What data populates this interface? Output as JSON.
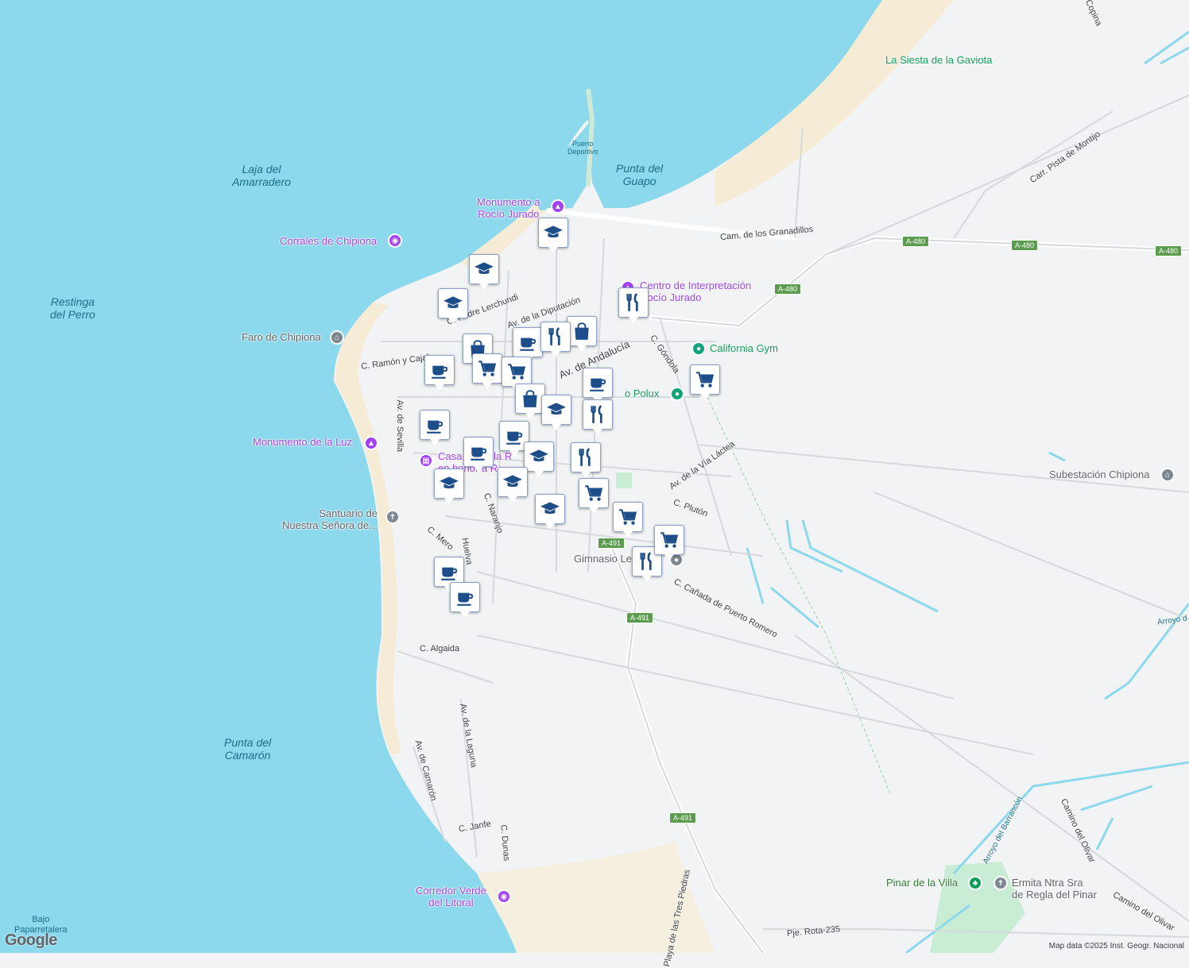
{
  "water_labels": [
    {
      "text": "Laja del\nAmarradero"
    },
    {
      "text": "Restinga\ndel Perro"
    },
    {
      "text": "Punta del\nCamarón"
    },
    {
      "text": "Punta del\nGuapo"
    },
    {
      "text": "Bajo\nPaparretalera"
    }
  ],
  "streets": {
    "c_padre_lerchundi": "C. Padre Lerchundi",
    "av_diputacion": "Av. de la Diputación",
    "av_andalucia": "Av. de Andalucía",
    "c_ramon_cajal": "C. Ramón y Cajal",
    "av_sevilla": "Av. de Sevilla",
    "c_gondola": "C. Góndola",
    "av_via_lactea": "Av. de la Vía Láctea",
    "c_pluton": "C. Plutón",
    "c_naranjo": "C. Naranjo",
    "c_mero": "C. Mero",
    "huelva": "Huelva",
    "c_canada": "C. Cañada de Puerto Romero",
    "c_algaida": "C. Algaida",
    "av_laguna": "Av. de la Laguna",
    "av_camaron": "Av. de Camarón",
    "c_janfe": "C. Janfe",
    "c_dunas": "C. Dunas",
    "cam_granadillos": "Cam. de los Granadillos",
    "carr_pista": "Carr. Pista de Montijo",
    "copina": "Copina",
    "tres_piedras": "Playa de las Tres Piedras",
    "pje_rota": "Pje. Rota-235",
    "camino_olivar": "Camino del Olivar",
    "camino_olivar2": "Camino del Olivar",
    "arroyo_barrancon": "Arroyo del Barrancón",
    "arroyo_edge": "Arroyo d"
  },
  "pois": {
    "monumento_rocio": "Monumento a\nRocío Jurado",
    "corrales": "Corrales de Chipiona",
    "faro": "Faro de Chipiona",
    "centro_interp": "Centro de Interpretación\nRocío Jurado",
    "california_gym": "California Gym",
    "polux": "o Polux",
    "monumento_luz": "Monumento de la Luz",
    "casa_escuela": "Casa Escuela R\nen honor a R",
    "santuario": "Santuario de\nNuestra Señora de...",
    "gimnasio": "Gimnasio Le",
    "subestacion": "Subestación Chipiona",
    "siesta": "La Siesta de la Gaviota",
    "puerto": "Puerto\nDeportivo",
    "corredor": "Corredor Verde\ndel Litoral",
    "pinar": "Pinar de la Villa",
    "ermita": "Ermita Ntra Sra\nde Regla del Pinar"
  },
  "roads": {
    "a480_1": "A-480",
    "a480_2": "A-480",
    "a480_3": "A-480",
    "a480_4": "A-480",
    "a491_1": "A-491",
    "a491_2": "A-491",
    "a491_3": "A-491"
  },
  "markers": [
    {
      "icon": "school-icon"
    },
    {
      "icon": "school-icon"
    },
    {
      "icon": "school-icon"
    },
    {
      "icon": "restaurant-icon"
    },
    {
      "icon": "shopping-bag-icon"
    },
    {
      "icon": "shopping-bag-icon"
    },
    {
      "icon": "coffee-icon"
    },
    {
      "icon": "coffee-icon"
    },
    {
      "icon": "shopping-cart-icon"
    },
    {
      "icon": "shopping-cart-icon"
    },
    {
      "icon": "coffee-icon"
    },
    {
      "icon": "coffee-icon"
    },
    {
      "icon": "restaurant-icon"
    },
    {
      "icon": "shopping-bag-icon"
    },
    {
      "icon": "school-icon"
    },
    {
      "icon": "restaurant-icon"
    },
    {
      "icon": "coffee-icon"
    },
    {
      "icon": "coffee-icon"
    },
    {
      "icon": "school-icon"
    },
    {
      "icon": "school-icon"
    },
    {
      "icon": "school-icon"
    },
    {
      "icon": "restaurant-icon"
    },
    {
      "icon": "shopping-cart-icon"
    },
    {
      "icon": "school-icon"
    },
    {
      "icon": "shopping-cart-icon"
    },
    {
      "icon": "shopping-cart-icon"
    },
    {
      "icon": "restaurant-icon"
    },
    {
      "icon": "coffee-icon"
    },
    {
      "icon": "coffee-icon"
    },
    {
      "icon": "shopping-cart-icon"
    }
  ],
  "attribution": "Map data ©2025 Inst. Geogr. Nacional",
  "logo": "Google",
  "colors": {
    "water": "#8cd8ec",
    "land": "#f1f3f4",
    "beach": "#f6ecd6",
    "marker_icon": "#1d4e89",
    "park": "#c9ecd4"
  }
}
